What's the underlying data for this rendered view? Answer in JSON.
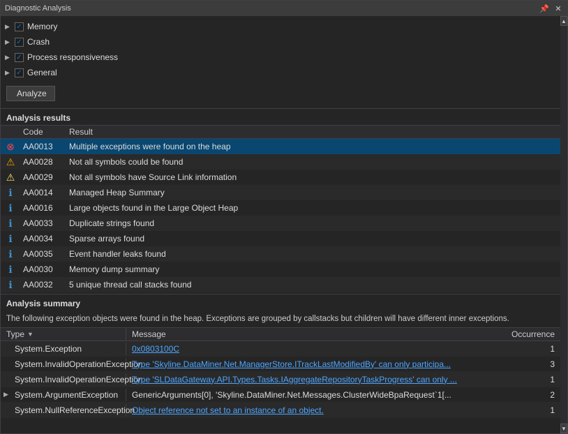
{
  "window": {
    "title": "Diagnostic Analysis"
  },
  "checklist": {
    "items": [
      {
        "id": "memory",
        "label": "Memory",
        "checked": true,
        "expanded": false
      },
      {
        "id": "crash",
        "label": "Crash",
        "checked": true,
        "expanded": false
      },
      {
        "id": "process-responsiveness",
        "label": "Process responsiveness",
        "checked": true,
        "expanded": false
      },
      {
        "id": "general",
        "label": "General",
        "checked": true,
        "expanded": false
      }
    ]
  },
  "analyze_button": "Analyze",
  "analysis_results": {
    "title": "Analysis results",
    "header": {
      "code": "Code",
      "result": "Result"
    },
    "rows": [
      {
        "icon": "error",
        "code": "AA0013",
        "result": "Multiple exceptions were found on the heap",
        "selected": true
      },
      {
        "icon": "warning-orange",
        "code": "AA0028",
        "result": "Not all symbols could be found",
        "selected": false
      },
      {
        "icon": "warning-yellow",
        "code": "AA0029",
        "result": "Not all symbols have Source Link information",
        "selected": false
      },
      {
        "icon": "info",
        "code": "AA0014",
        "result": "Managed Heap Summary",
        "selected": false
      },
      {
        "icon": "info",
        "code": "AA0016",
        "result": "Large objects found in the Large Object Heap",
        "selected": false
      },
      {
        "icon": "info",
        "code": "AA0033",
        "result": "Duplicate strings found",
        "selected": false
      },
      {
        "icon": "info",
        "code": "AA0034",
        "result": "Sparse arrays found",
        "selected": false
      },
      {
        "icon": "info",
        "code": "AA0035",
        "result": "Event handler leaks found",
        "selected": false
      },
      {
        "icon": "info",
        "code": "AA0030",
        "result": "Memory dump summary",
        "selected": false
      },
      {
        "icon": "info",
        "code": "AA0032",
        "result": "5 unique thread call stacks found",
        "selected": false
      }
    ]
  },
  "analysis_summary": {
    "title": "Analysis summary",
    "description": "The following exception objects were found in the heap. Exceptions are grouped by callstacks but children will have different inner exceptions.",
    "header": {
      "type": "Type",
      "message": "Message",
      "occurrence": "Occurrence"
    },
    "rows": [
      {
        "expand": false,
        "type": "System.Exception",
        "message": "0x0803100C",
        "message_link": true,
        "occurrence": "1"
      },
      {
        "expand": false,
        "type": "System.InvalidOperationException",
        "message": "Type 'Skyline.DataMiner.Net.ManagerStore.ITrackLastModifiedBy' can only participa...",
        "message_link": true,
        "occurrence": "3"
      },
      {
        "expand": false,
        "type": "System.InvalidOperationException",
        "message": "Type 'SLDataGateway.API.Types.Tasks.IAggregateRepositoryTaskProgress' can only ...",
        "message_link": true,
        "occurrence": "1"
      },
      {
        "expand": true,
        "type": "System.ArgumentException",
        "message": "GenericArguments[0], 'Skyline.DataMiner.Net.Messages.ClusterWideBpaRequest`1[...",
        "message_link": false,
        "occurrence": "2"
      },
      {
        "expand": false,
        "type": "System.NullReferenceException",
        "message": "Object reference not set to an instance of an object.",
        "message_link": true,
        "occurrence": "1"
      }
    ]
  }
}
